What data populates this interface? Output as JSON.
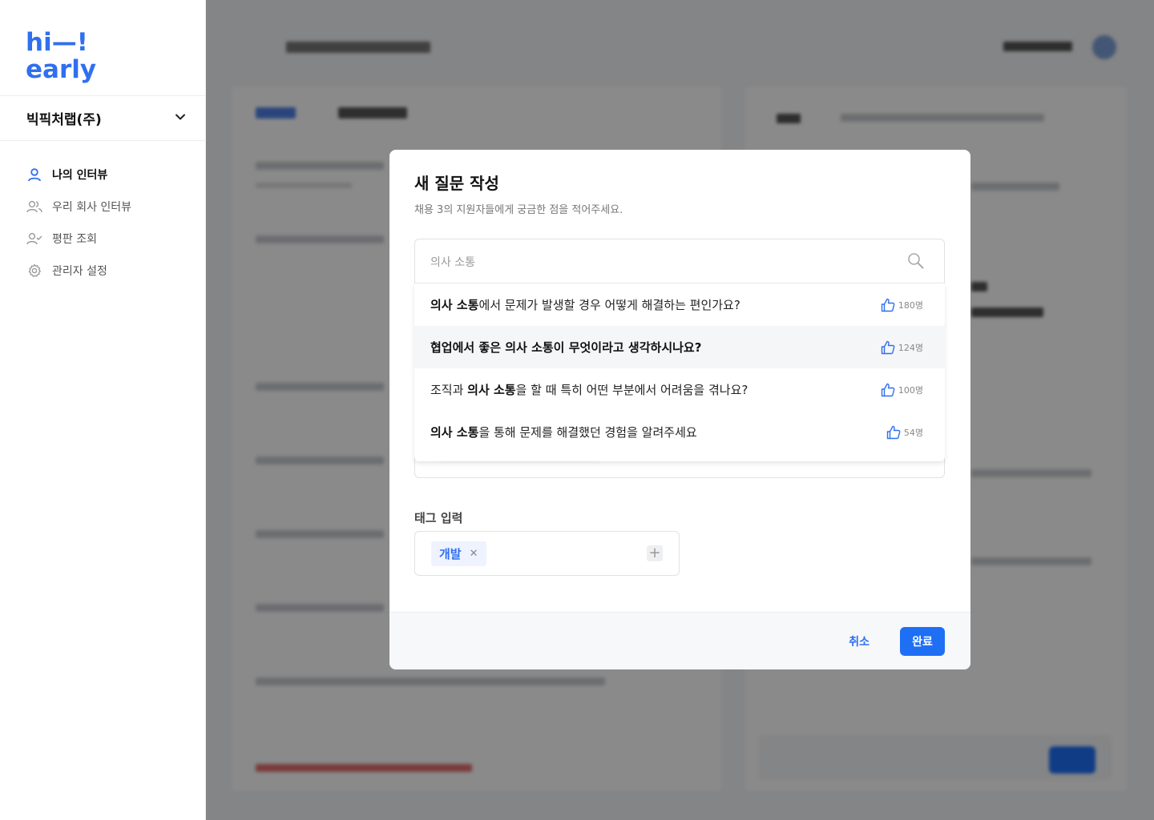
{
  "sidebar": {
    "logo_line1": "hi—!",
    "logo_line2": "early",
    "company": "빅픽처랩(주)",
    "nav": [
      {
        "label": "나의 인터뷰",
        "icon": "user-icon",
        "active": true
      },
      {
        "label": "우리 회사 인터뷰",
        "icon": "users-icon",
        "active": false
      },
      {
        "label": "평판 조회",
        "icon": "user-check-icon",
        "active": false
      },
      {
        "label": "관리자 설정",
        "icon": "gear-icon",
        "active": false
      }
    ]
  },
  "modal": {
    "title": "새 질문 작성",
    "subtitle": "채용 3의 지원자들에게 궁금한 점을 적어주세요.",
    "search": {
      "value": "의사 소통",
      "placeholder": "의사 소통"
    },
    "suggestions": [
      {
        "bold": "의사 소통",
        "rest": "에서 문제가 발생할 경우 어떻게 해결하는 편인가요?",
        "likes": "180명"
      },
      {
        "full": "협업에서 좋은 의사 소통이 무엇이라고 생각하시나요?",
        "likes": "124명"
      },
      {
        "prefix": "조직과 ",
        "bold": "의사 소통",
        "rest": "을 할 때 특히 어떤 부분에서 어려움을 겪나요?",
        "likes": "100명"
      },
      {
        "bold": "의사 소통",
        "rest": "을 통해 문제를 해결했던 경험을 알려주세요",
        "likes": "54명"
      }
    ],
    "tag_label": "태그 입력",
    "tags": [
      "개발"
    ],
    "cancel_label": "취소",
    "done_label": "완료"
  },
  "colors": {
    "accent": "#1f6ff5",
    "logo": "#2f6ff0"
  }
}
